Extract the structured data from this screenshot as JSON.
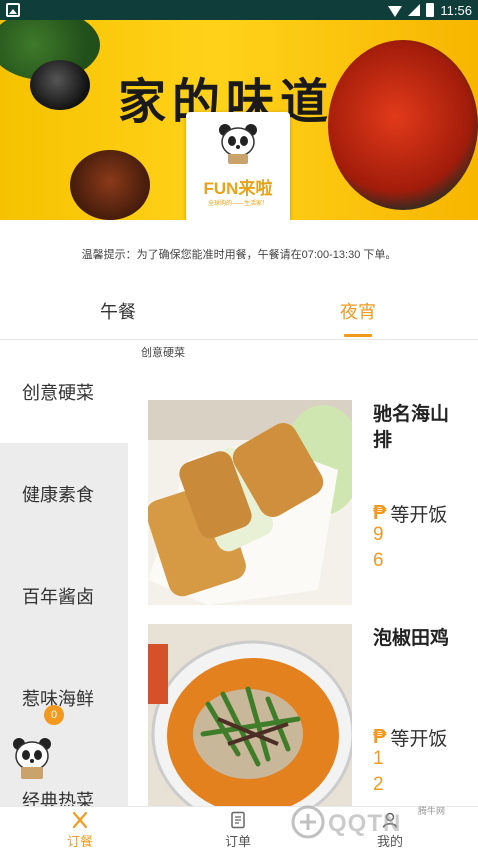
{
  "status_bar": {
    "time": "11:56"
  },
  "banner": {
    "title": "家的味道",
    "logo_brand": "FUN来啦",
    "logo_slogan": "全球购的——生活家！"
  },
  "notice": "温馨提示：为了确保您能准时用餐，午餐请在07:00-13:30 下单。",
  "meal_tabs": [
    {
      "label": "午餐",
      "active": false
    },
    {
      "label": "夜宵",
      "active": true
    }
  ],
  "section_label": "创意硬菜",
  "categories": [
    {
      "label": "创意硬菜",
      "active": true
    },
    {
      "label": "健康素食",
      "active": false
    },
    {
      "label": "百年酱卤",
      "active": false
    },
    {
      "label": "惹味海鲜",
      "active": false
    },
    {
      "label": "经典热菜",
      "active": false
    }
  ],
  "cart_badge": "0",
  "dishes": [
    {
      "name": "驰名海山排",
      "currency": "₱",
      "price_text": "等开饭",
      "digits": [
        "9",
        "6"
      ]
    },
    {
      "name": "泡椒田鸡",
      "currency": "₱",
      "price_text": "等开饭",
      "digits": [
        "1",
        "2"
      ]
    }
  ],
  "bottom_nav": [
    {
      "label": "订餐",
      "icon": "utensils-icon",
      "active": true
    },
    {
      "label": "订单",
      "icon": "document-icon",
      "active": false
    },
    {
      "label": "我的",
      "icon": "user-icon",
      "active": false
    }
  ],
  "watermark": {
    "text": "QQTN",
    "small": "腾牛网"
  },
  "colors": {
    "accent": "#f39a1e",
    "status_bar": "#0f3d3a",
    "sidebar_bg": "#ececec"
  }
}
